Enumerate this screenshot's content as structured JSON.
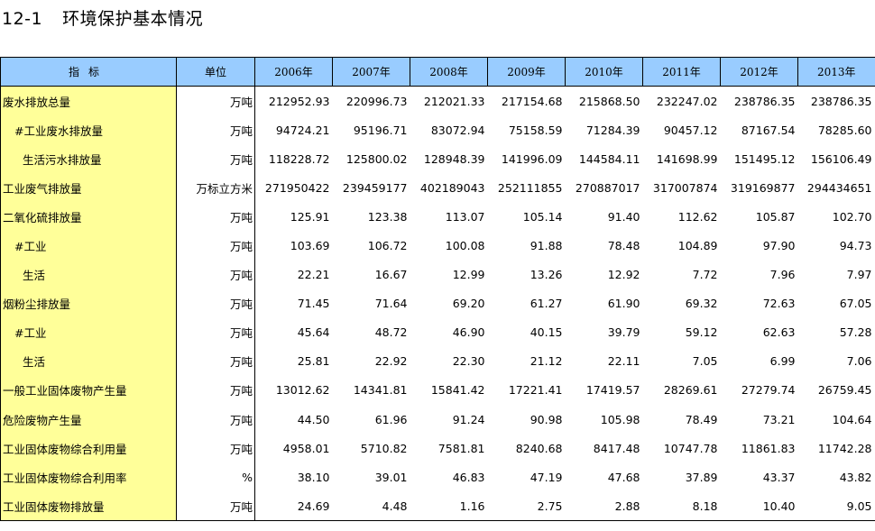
{
  "title": {
    "number": "12-1",
    "text": "环境保护基本情况"
  },
  "header": {
    "indicator": "指标",
    "unit": "单位",
    "years": [
      "2006年",
      "2007年",
      "2008年",
      "2009年",
      "2010年",
      "2011年",
      "2012年",
      "2013年"
    ]
  },
  "rows": [
    {
      "label": "废水排放总量",
      "indent": 0,
      "unit": "万吨",
      "values": [
        "212952.93",
        "220996.73",
        "212021.33",
        "217154.68",
        "215868.50",
        "232247.02",
        "238786.35",
        "238786.35"
      ]
    },
    {
      "label": "#工业废水排放量",
      "indent": 1,
      "unit": "万吨",
      "values": [
        "94724.21",
        "95196.71",
        "83072.94",
        "75158.59",
        "71284.39",
        "90457.12",
        "87167.54",
        "78285.60"
      ]
    },
    {
      "label": "生活污水排放量",
      "indent": 2,
      "unit": "万吨",
      "values": [
        "118228.72",
        "125800.02",
        "128948.39",
        "141996.09",
        "144584.11",
        "141698.99",
        "151495.12",
        "156106.49"
      ]
    },
    {
      "label": "工业废气排放量",
      "indent": 0,
      "unit": "万标立方米",
      "values": [
        "271950422",
        "239459177",
        "402189043",
        "252111855",
        "270887017",
        "317007874",
        "319169877",
        "294434651"
      ]
    },
    {
      "label": "二氧化硫排放量",
      "indent": 0,
      "unit": "万吨",
      "values": [
        "125.91",
        "123.38",
        "113.07",
        "105.14",
        "91.40",
        "112.62",
        "105.87",
        "102.70"
      ]
    },
    {
      "label": "#工业",
      "indent": 1,
      "unit": "万吨",
      "values": [
        "103.69",
        "106.72",
        "100.08",
        "91.88",
        "78.48",
        "104.89",
        "97.90",
        "94.73"
      ]
    },
    {
      "label": "生活",
      "indent": 2,
      "unit": "万吨",
      "values": [
        "22.21",
        "16.67",
        "12.99",
        "13.26",
        "12.92",
        "7.72",
        "7.96",
        "7.97"
      ]
    },
    {
      "label": "烟粉尘排放量",
      "indent": 0,
      "unit": "万吨",
      "values": [
        "71.45",
        "71.64",
        "69.20",
        "61.27",
        "61.90",
        "69.32",
        "72.63",
        "67.05"
      ]
    },
    {
      "label": "#工业",
      "indent": 1,
      "unit": "万吨",
      "values": [
        "45.64",
        "48.72",
        "46.90",
        "40.15",
        "39.79",
        "59.12",
        "62.63",
        "57.28"
      ]
    },
    {
      "label": "生活",
      "indent": 2,
      "unit": "万吨",
      "values": [
        "25.81",
        "22.92",
        "22.30",
        "21.12",
        "22.11",
        "7.05",
        "6.99",
        "7.06"
      ]
    },
    {
      "label": "一般工业固体废物产生量",
      "indent": 0,
      "unit": "万吨",
      "values": [
        "13012.62",
        "14341.81",
        "15841.42",
        "17221.41",
        "17419.57",
        "28269.61",
        "27279.74",
        "26759.45"
      ]
    },
    {
      "label": "危险废物产生量",
      "indent": 0,
      "unit": "万吨",
      "values": [
        "44.50",
        "61.96",
        "91.24",
        "90.98",
        "105.98",
        "78.49",
        "73.21",
        "104.64"
      ]
    },
    {
      "label": "工业固体废物综合利用量",
      "indent": 0,
      "unit": "万吨",
      "values": [
        "4958.01",
        "5710.82",
        "7581.81",
        "8240.68",
        "8417.48",
        "10747.78",
        "11861.83",
        "11742.28"
      ]
    },
    {
      "label": "工业固体废物综合利用率",
      "indent": 0,
      "unit": "%",
      "values": [
        "38.10",
        "39.01",
        "46.83",
        "47.19",
        "47.68",
        "37.89",
        "43.37",
        "43.82"
      ]
    },
    {
      "label": "工业固体废物排放量",
      "indent": 0,
      "unit": "万吨",
      "values": [
        "24.69",
        "4.48",
        "1.16",
        "2.75",
        "2.88",
        "8.18",
        "10.40",
        "9.05"
      ]
    }
  ]
}
